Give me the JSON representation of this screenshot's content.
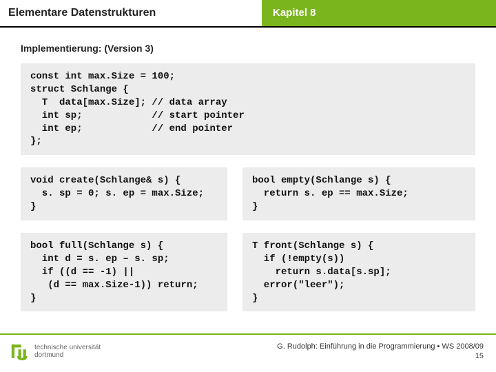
{
  "header": {
    "title": "Elementare Datenstrukturen",
    "chapter": "Kapitel 8"
  },
  "subtitle": "Implementierung: (Version 3)",
  "code": {
    "block1": "const int max.Size = 100;\nstruct Schlange {\n  T  data[max.Size]; // data array\n  int sp;            // start pointer\n  int ep;            // end pointer\n};",
    "create": "void create(Schlange& s) {\n  s. sp = 0; s. ep = max.Size;\n}",
    "empty": "bool empty(Schlange s) {\n  return s. ep == max.Size;\n}",
    "full": "bool full(Schlange s) {\n  int d = s. ep – s. sp;\n  if ((d == -1) ||\n   (d == max.Size-1)) return;\n}",
    "front": "T front(Schlange s) {\n  if (!empty(s))\n    return s.data[s.sp];\n  error(\"leer\");\n}"
  },
  "footer": {
    "uni_line1": "technische universität",
    "uni_line2": "dortmund",
    "credit": "G. Rudolph: Einführung in die Programmierung ▪ WS 2008/09",
    "page": "15"
  }
}
